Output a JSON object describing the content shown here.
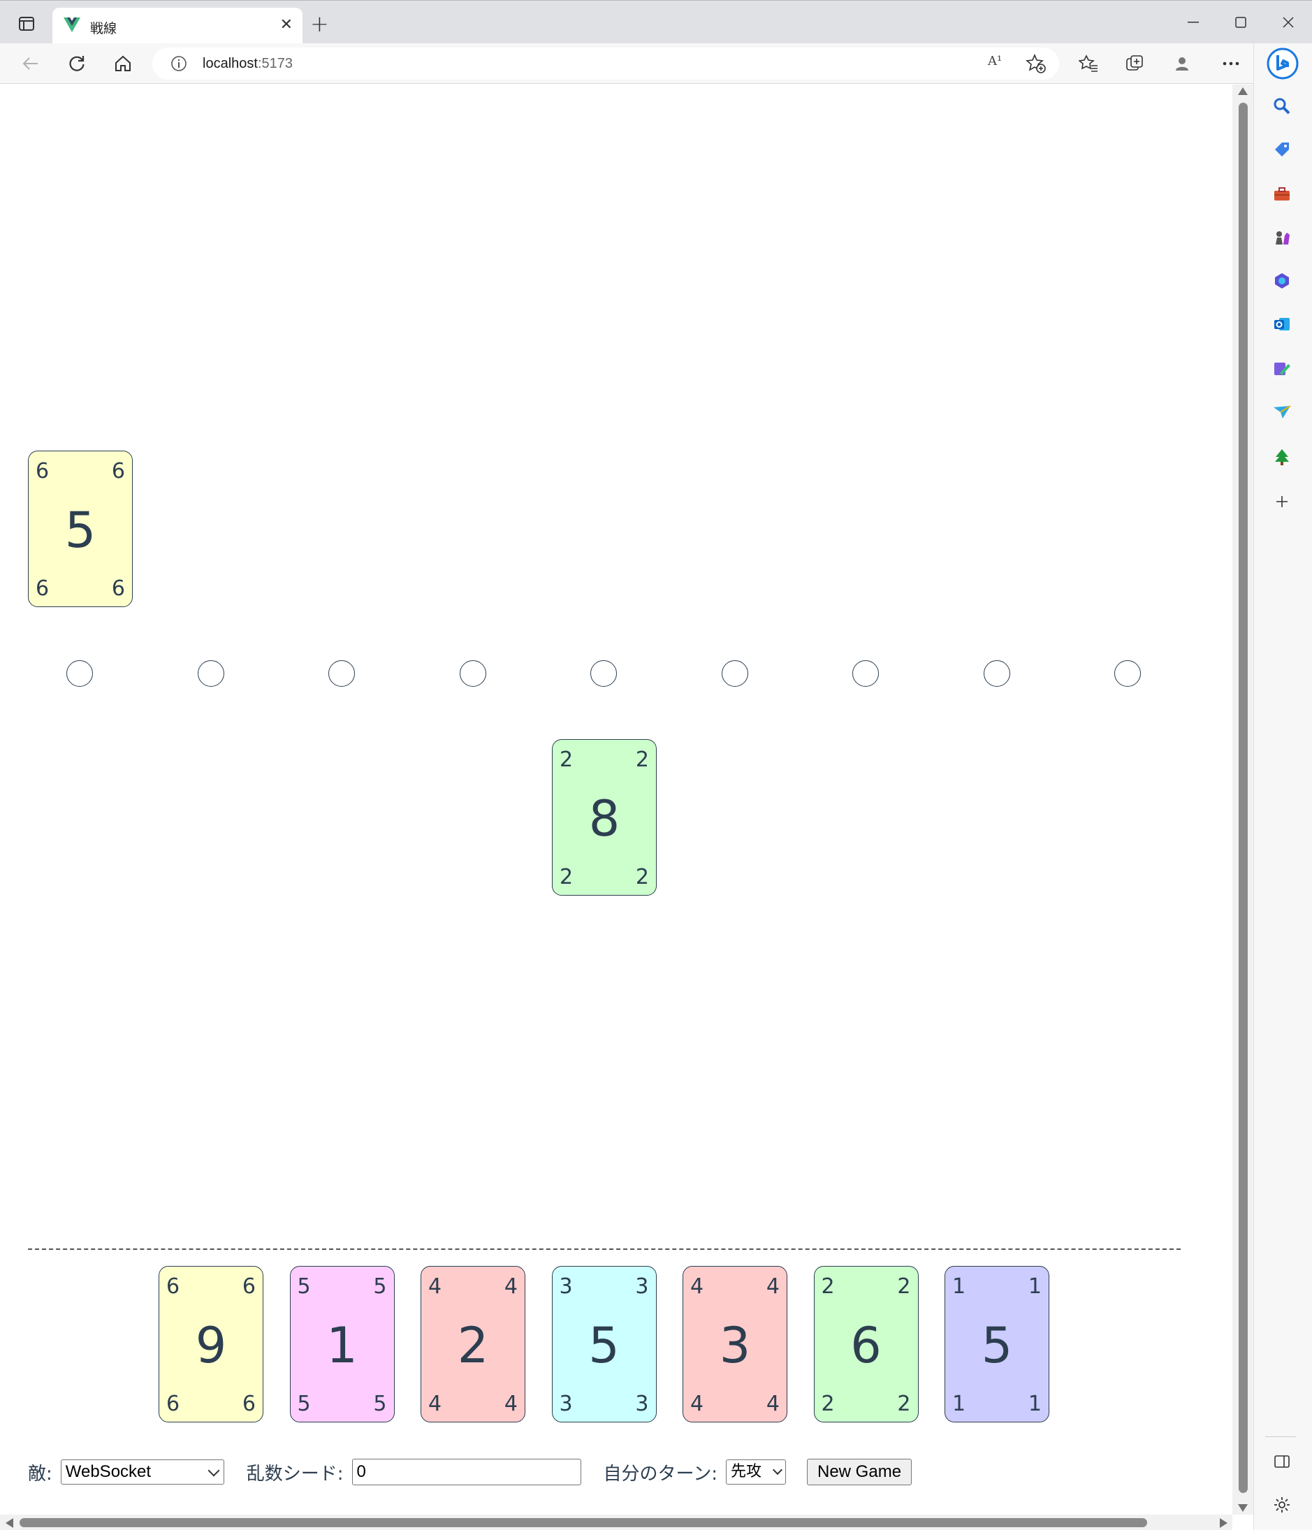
{
  "browser": {
    "tab_title": "戦線",
    "url_host": "localhost",
    "url_port": ":5173",
    "read_aloud_label": "A¹"
  },
  "game": {
    "opponent_card": {
      "corner": "6",
      "number": "5",
      "color": "#ffffcc"
    },
    "flag_count": 9,
    "field_card": {
      "corner": "2",
      "number": "8",
      "color": "#ccffcc"
    },
    "hand": [
      {
        "corner": "6",
        "number": "9",
        "color": "#ffffcc"
      },
      {
        "corner": "5",
        "number": "1",
        "color": "#ffccff"
      },
      {
        "corner": "4",
        "number": "2",
        "color": "#ffcccc"
      },
      {
        "corner": "3",
        "number": "5",
        "color": "#ccffff"
      },
      {
        "corner": "4",
        "number": "3",
        "color": "#ffcccc"
      },
      {
        "corner": "2",
        "number": "6",
        "color": "#ccffcc"
      },
      {
        "corner": "1",
        "number": "5",
        "color": "#ccccff"
      }
    ]
  },
  "controls": {
    "enemy_label": "敵:",
    "enemy_value": "WebSocket",
    "seed_label": "乱数シード:",
    "seed_value": "0",
    "turn_label": "自分のターン:",
    "turn_value": "先攻",
    "new_game_label": "New Game"
  }
}
